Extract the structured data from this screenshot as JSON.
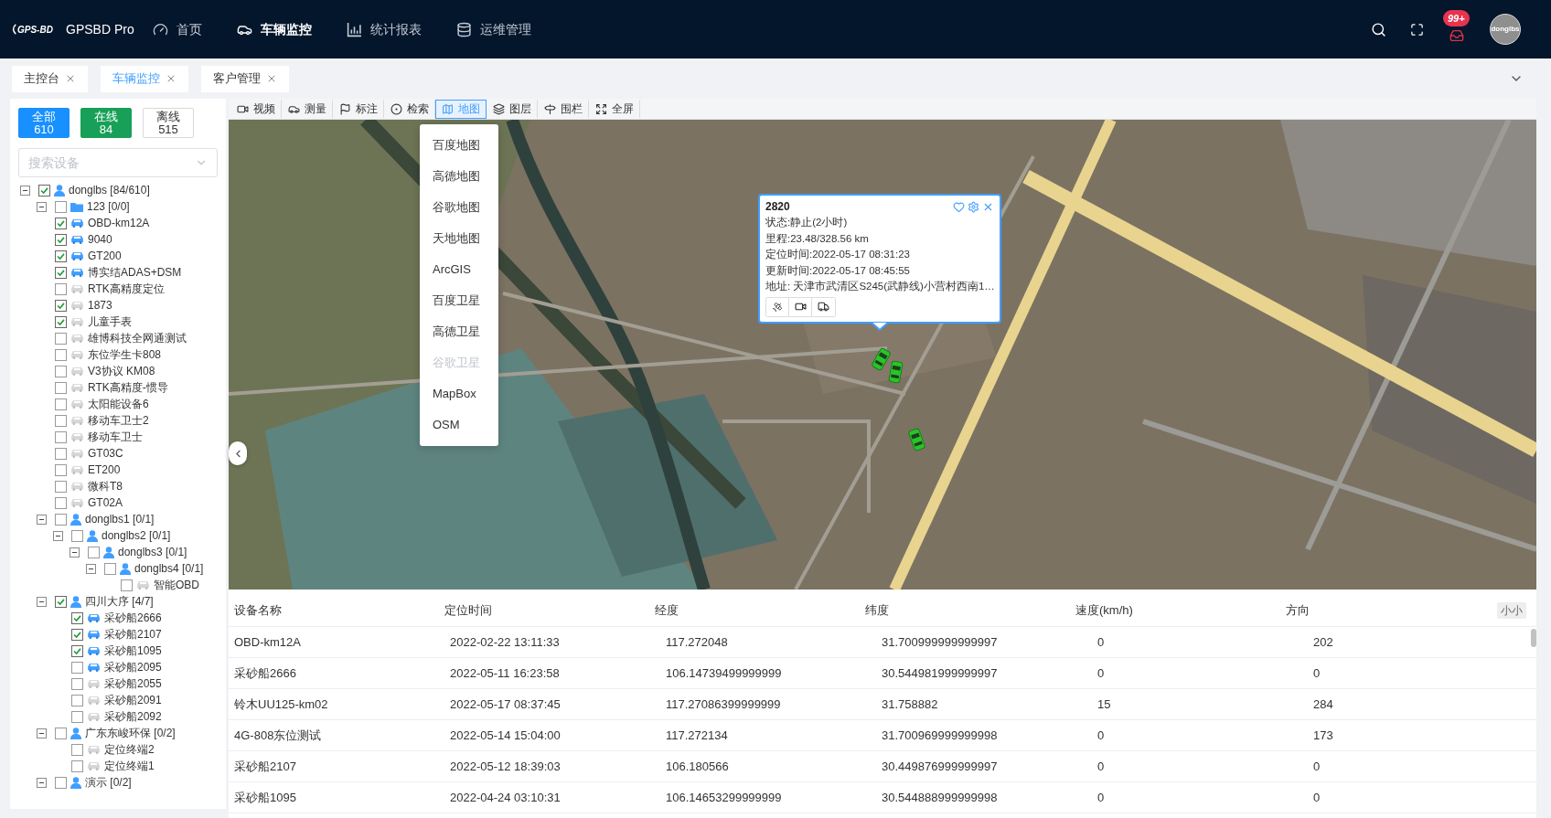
{
  "header": {
    "logo_text": "GPS-BD",
    "app_name": "GPSBD Pro",
    "nav": [
      {
        "label": "首页",
        "selected": false
      },
      {
        "label": "车辆监控",
        "selected": true
      },
      {
        "label": "统计报表",
        "selected": false
      },
      {
        "label": "运维管理",
        "selected": false
      }
    ],
    "notification_badge": "99+",
    "avatar_text": "donglbs"
  },
  "tabs": [
    {
      "label": "主控台",
      "selected": false
    },
    {
      "label": "车辆监控",
      "selected": true
    },
    {
      "label": "客户管理",
      "selected": false
    }
  ],
  "device_filters": [
    {
      "kind": "all",
      "label": "全部",
      "count": "610"
    },
    {
      "kind": "online",
      "label": "在线",
      "count": "84"
    },
    {
      "kind": "offline",
      "label": "离线",
      "count": "515"
    }
  ],
  "device_search": {
    "placeholder": "搜索设备"
  },
  "tree": [
    {
      "label": "donglbs [84/610]",
      "kind": "user",
      "checked": true,
      "expanded": true,
      "children": [
        {
          "label": "123 [0/0]",
          "kind": "folder",
          "checked": false,
          "expanded": true
        },
        {
          "label": "OBD-km12A",
          "kind": "device",
          "checked": true,
          "online": true
        },
        {
          "label": "9040",
          "kind": "device",
          "checked": true,
          "online": true
        },
        {
          "label": "GT200",
          "kind": "device",
          "checked": true,
          "online": true
        },
        {
          "label": "博实结ADAS+DSM",
          "kind": "device",
          "checked": true,
          "online": true
        },
        {
          "label": "RTK高精度定位",
          "kind": "device",
          "checked": false,
          "online": false
        },
        {
          "label": "1873",
          "kind": "device",
          "checked": true,
          "online": false
        },
        {
          "label": "儿童手表",
          "kind": "device",
          "checked": true,
          "online": false
        },
        {
          "label": "雄博科技全网通测试",
          "kind": "device",
          "checked": false,
          "online": false
        },
        {
          "label": "东位学生卡808",
          "kind": "device",
          "checked": false,
          "online": false
        },
        {
          "label": "V3协议 KM08",
          "kind": "device",
          "checked": false,
          "online": false
        },
        {
          "label": "RTK高精度-惯导",
          "kind": "device",
          "checked": false,
          "online": false
        },
        {
          "label": "太阳能设备6",
          "kind": "device",
          "checked": false,
          "online": false
        },
        {
          "label": "移动车卫士2",
          "kind": "device",
          "checked": false,
          "online": false
        },
        {
          "label": "移动车卫士",
          "kind": "device",
          "checked": false,
          "online": false
        },
        {
          "label": "GT03C",
          "kind": "device",
          "checked": false,
          "online": false
        },
        {
          "label": "ET200",
          "kind": "device",
          "checked": false,
          "online": false
        },
        {
          "label": "微科T8",
          "kind": "device",
          "checked": false,
          "online": false
        },
        {
          "label": "GT02A",
          "kind": "device",
          "checked": false,
          "online": false
        },
        {
          "label": "donglbs1 [0/1]",
          "kind": "user",
          "checked": false,
          "expanded": true,
          "children": [
            {
              "label": "donglbs2 [0/1]",
              "kind": "user",
              "checked": false,
              "expanded": true,
              "children": [
                {
                  "label": "donglbs3 [0/1]",
                  "kind": "user",
                  "checked": false,
                  "expanded": true,
                  "children": [
                    {
                      "label": "donglbs4 [0/1]",
                      "kind": "user",
                      "checked": false,
                      "expanded": true,
                      "children": [
                        {
                          "label": "智能OBD",
                          "kind": "device",
                          "checked": false,
                          "online": false
                        }
                      ]
                    }
                  ]
                }
              ]
            }
          ]
        },
        {
          "label": "四川大序 [4/7]",
          "kind": "user",
          "checked": true,
          "expanded": true,
          "children": [
            {
              "label": "采砂船2666",
              "kind": "device",
              "checked": true,
              "online": true
            },
            {
              "label": "采砂船2107",
              "kind": "device",
              "checked": true,
              "online": true
            },
            {
              "label": "采砂船1095",
              "kind": "device",
              "checked": true,
              "online": true
            },
            {
              "label": "采砂船2095",
              "kind": "device",
              "checked": false,
              "online": true
            },
            {
              "label": "采砂船2055",
              "kind": "device",
              "checked": false,
              "online": false
            },
            {
              "label": "采砂船2091",
              "kind": "device",
              "checked": false,
              "online": false
            },
            {
              "label": "采砂船2092",
              "kind": "device",
              "checked": false,
              "online": false
            }
          ]
        },
        {
          "label": "广东东峻环保 [0/2]",
          "kind": "user",
          "checked": false,
          "expanded": true,
          "children": [
            {
              "label": "定位终端2",
              "kind": "device",
              "checked": false,
              "online": false
            },
            {
              "label": "定位终端1",
              "kind": "device",
              "checked": false,
              "online": false
            }
          ]
        },
        {
          "label": "演示 [0/2]",
          "kind": "user",
          "checked": false,
          "expanded": true
        }
      ]
    }
  ],
  "map_toolbar": [
    {
      "label": "视频",
      "selected": false
    },
    {
      "label": "测量",
      "selected": false
    },
    {
      "label": "标注",
      "selected": false
    },
    {
      "label": "检索",
      "selected": false
    },
    {
      "label": "地图",
      "selected": true
    },
    {
      "label": "图层",
      "selected": false
    },
    {
      "label": "围栏",
      "selected": false
    },
    {
      "label": "全屏",
      "selected": false
    }
  ],
  "map_type_menu": [
    {
      "label": "百度地图",
      "selected": false
    },
    {
      "label": "高德地图",
      "selected": false
    },
    {
      "label": "谷歌地图",
      "selected": false
    },
    {
      "label": "天地地图",
      "selected": false
    },
    {
      "label": "ArcGIS",
      "selected": false
    },
    {
      "label": "百度卫星",
      "selected": false
    },
    {
      "label": "高德卫星",
      "selected": false
    },
    {
      "label": "谷歌卫星",
      "selected": true
    },
    {
      "label": "MapBox",
      "selected": false
    },
    {
      "label": "OSM",
      "selected": false
    }
  ],
  "vehicle_popup": {
    "title": "2820",
    "fields": [
      "状态:静止(2小时)",
      "里程:23.48/328.56 km",
      "定位时间:2022-05-17 08:31:23",
      "更新时间:2022-05-17 08:45:55",
      "地址: 天津市武清区S245(武静线)小营村西南1…"
    ]
  },
  "table": {
    "columns": [
      "设备名称",
      "定位时间",
      "经度",
      "纬度",
      "速度(km/h)",
      "方向"
    ],
    "size_toggle": "小小",
    "rows": [
      [
        "OBD-km12A",
        "2022-02-22 13:11:33",
        "117.272048",
        "31.700999999999997",
        "0",
        "202"
      ],
      [
        "采砂船2666",
        "2022-05-11 16:23:58",
        "106.14739499999999",
        "30.544981999999997",
        "0",
        "0"
      ],
      [
        "铃木UU125-km02",
        "2022-05-17 08:37:45",
        "117.27086399999999",
        "31.758882",
        "15",
        "284"
      ],
      [
        "4G-808东位测试",
        "2022-05-14 15:04:00",
        "117.272134",
        "31.700969999999998",
        "0",
        "173"
      ],
      [
        "采砂船2107",
        "2022-05-12 18:39:03",
        "106.180566",
        "30.449876999999997",
        "0",
        "0"
      ],
      [
        "采砂船1095",
        "2022-04-24 03:10:31",
        "106.14653299999999",
        "30.544888999999998",
        "0",
        "0"
      ]
    ]
  }
}
